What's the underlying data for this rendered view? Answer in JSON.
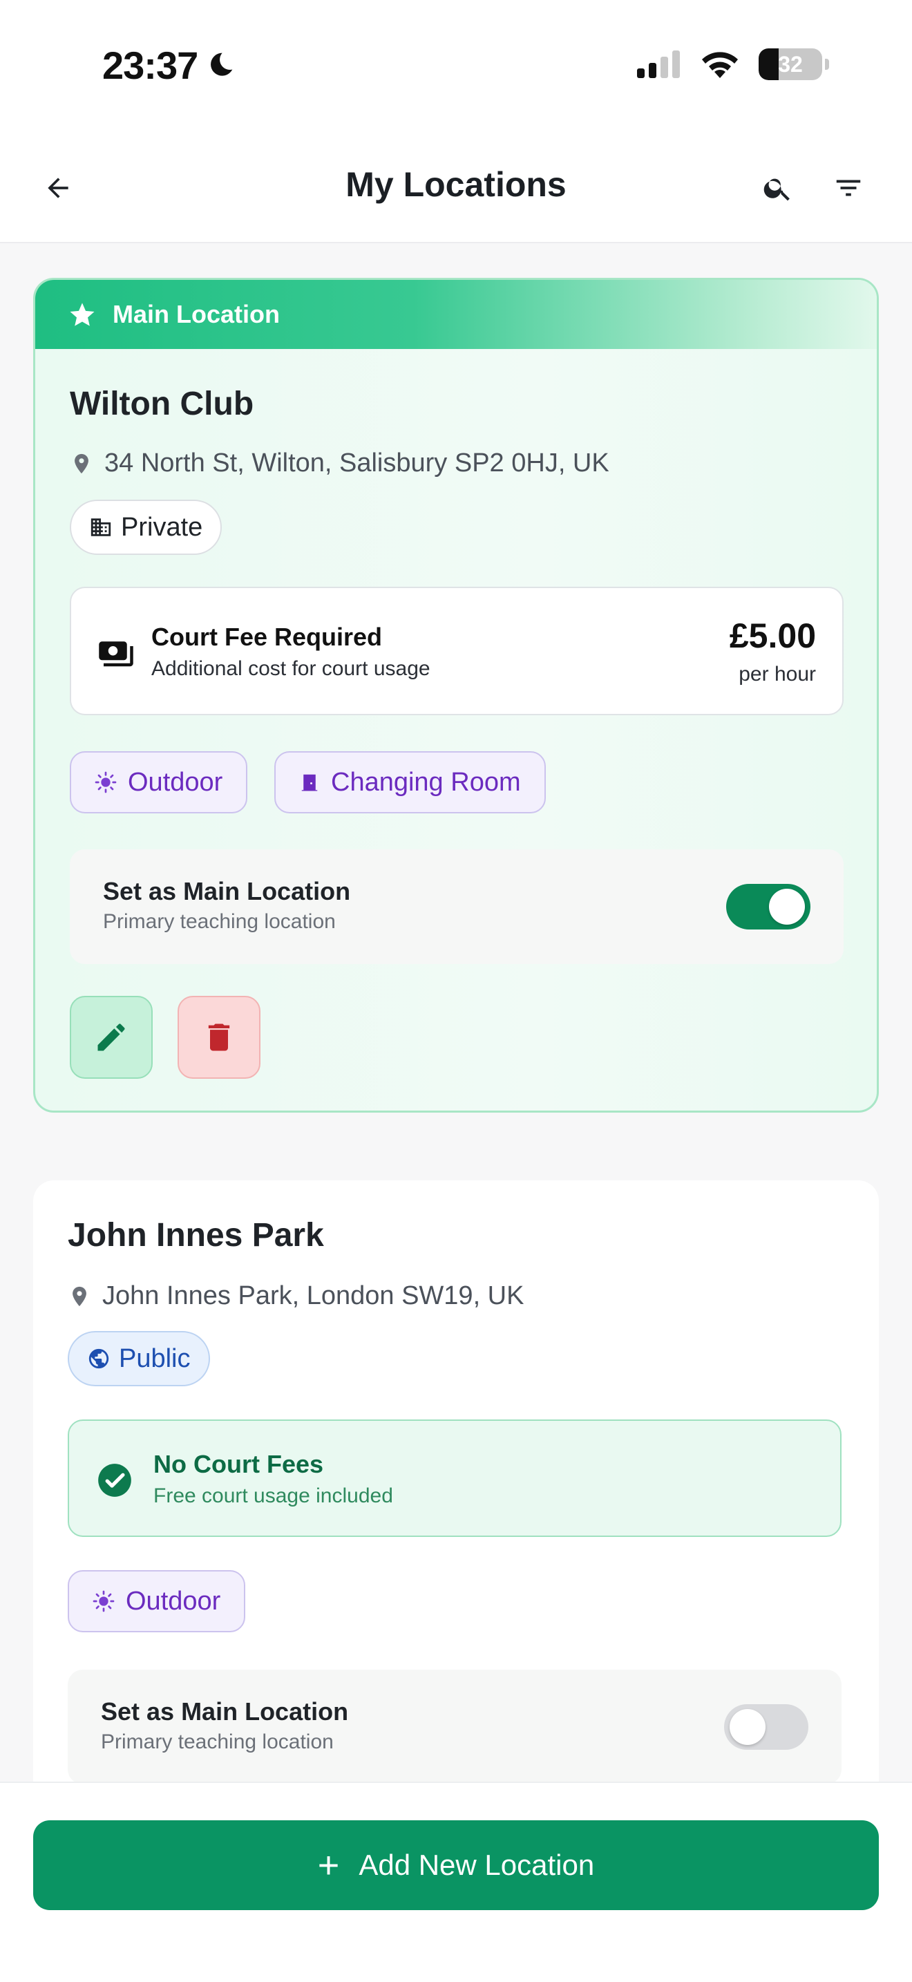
{
  "status_bar": {
    "time": "23:37",
    "battery": "32",
    "battery_level": 0.32
  },
  "header": {
    "title": "My Locations"
  },
  "locations": [
    {
      "banner": "Main Location",
      "name": "Wilton Club",
      "address": "34 North St, Wilton, Salisbury SP2 0HJ, UK",
      "type": "Private",
      "fee": {
        "title": "Court Fee Required",
        "subtitle": "Additional cost for court usage",
        "price": "£5.00",
        "unit": "per hour"
      },
      "amenities": [
        "Outdoor",
        "Changing Room"
      ],
      "main_setting": {
        "title": "Set as Main Location",
        "subtitle": "Primary teaching location",
        "enabled": true
      }
    },
    {
      "name": "John Innes Park",
      "address": "John Innes Park, London SW19, UK",
      "type": "Public",
      "fee": {
        "title": "No Court Fees",
        "subtitle": "Free court usage included"
      },
      "amenities": [
        "Outdoor"
      ],
      "main_setting": {
        "title": "Set as Main Location",
        "subtitle": "Primary teaching location",
        "enabled": false
      }
    }
  ],
  "footer": {
    "add_label": "Add New Location"
  },
  "colors": {
    "accent": "#0a9463",
    "toggle_on": "#0a8a58",
    "amenity_text": "#6b2bbf",
    "public_chip": "#1d4fb0",
    "delete_icon": "#c0272d"
  },
  "icons": {
    "back": "arrow-left-icon",
    "search": "search-icon",
    "filter": "filter-icon",
    "star": "star-icon",
    "pin": "map-pin-icon",
    "building": "building-icon",
    "globe": "globe-icon",
    "money": "money-icon",
    "check": "check-circle-icon",
    "sun": "sun-icon",
    "door": "door-icon",
    "edit": "pencil-icon",
    "delete": "trash-icon",
    "plus": "plus-icon"
  }
}
